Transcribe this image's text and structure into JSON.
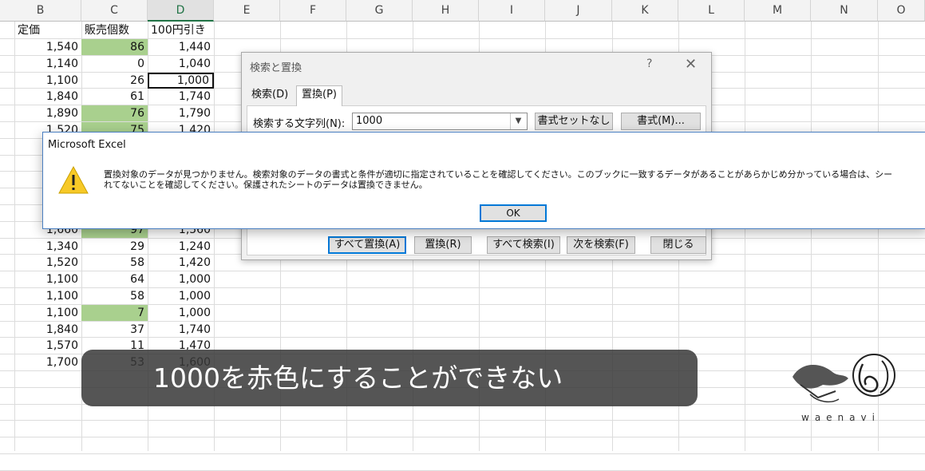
{
  "sheet": {
    "columns": [
      "B",
      "C",
      "D",
      "E",
      "F",
      "G",
      "H",
      "I",
      "J",
      "K",
      "L",
      "M",
      "N",
      "O"
    ],
    "selected_column": "D",
    "header_row": [
      "定価",
      "販売個数",
      "100円引き"
    ],
    "rows": [
      {
        "b": "1,540",
        "c": "86",
        "d": "1,440",
        "hl": true
      },
      {
        "b": "1,140",
        "c": "0",
        "d": "1,040",
        "hl": false
      },
      {
        "b": "1,100",
        "c": "26",
        "d": "1,000",
        "hl": false,
        "active": true
      },
      {
        "b": "1,840",
        "c": "61",
        "d": "1,740",
        "hl": false
      },
      {
        "b": "1,890",
        "c": "76",
        "d": "1,790",
        "hl": true
      },
      {
        "b": "1,520",
        "c": "75",
        "d": "1,420",
        "hl": true
      },
      {
        "b": "1,660",
        "c": "97",
        "d": "1,560",
        "hl": true
      },
      {
        "b": "1,340",
        "c": "29",
        "d": "1,240",
        "hl": false
      },
      {
        "b": "1,520",
        "c": "58",
        "d": "1,420",
        "hl": false
      },
      {
        "b": "1,100",
        "c": "64",
        "d": "1,000",
        "hl": false
      },
      {
        "b": "1,100",
        "c": "58",
        "d": "1,000",
        "hl": false
      },
      {
        "b": "1,100",
        "c": "7",
        "d": "1,000",
        "hl": true
      },
      {
        "b": "1,840",
        "c": "37",
        "d": "1,740",
        "hl": false
      },
      {
        "b": "1,570",
        "c": "11",
        "d": "1,470",
        "hl": false
      },
      {
        "b": "1,700",
        "c": "53",
        "d": "1,600",
        "hl": false
      }
    ]
  },
  "find_replace": {
    "title": "検索と置換",
    "help": "?",
    "close": "✕",
    "tab_search": "検索(D)",
    "tab_replace": "置換(P)",
    "find_label": "検索する文字列(N):",
    "find_value": "1000",
    "no_format_button": "書式セットなし",
    "format_button": "書式(M)...",
    "replace_all": "すべて置換(A)",
    "replace": "置換(R)",
    "find_all": "すべて検索(I)",
    "find_next": "次を検索(F)",
    "close_button": "閉じる"
  },
  "message_box": {
    "title": "Microsoft Excel",
    "line1": "置換対象のデータが見つかりません。検索対象のデータの書式と条件が適切に指定されていることを確認してください。このブックに一致するデータがあることがあらかじめ分かっている場合は、シー",
    "line2": "れてないことを確認してください。保護されたシートのデータは置換できません。",
    "ok": "OK",
    "icon": "warning-icon"
  },
  "caption": "1000を赤色にすることができない",
  "logo_text": "waenavi",
  "colors": {
    "highlight": "#a9d08e",
    "accent": "#0078d7",
    "excel_green": "#217346"
  }
}
